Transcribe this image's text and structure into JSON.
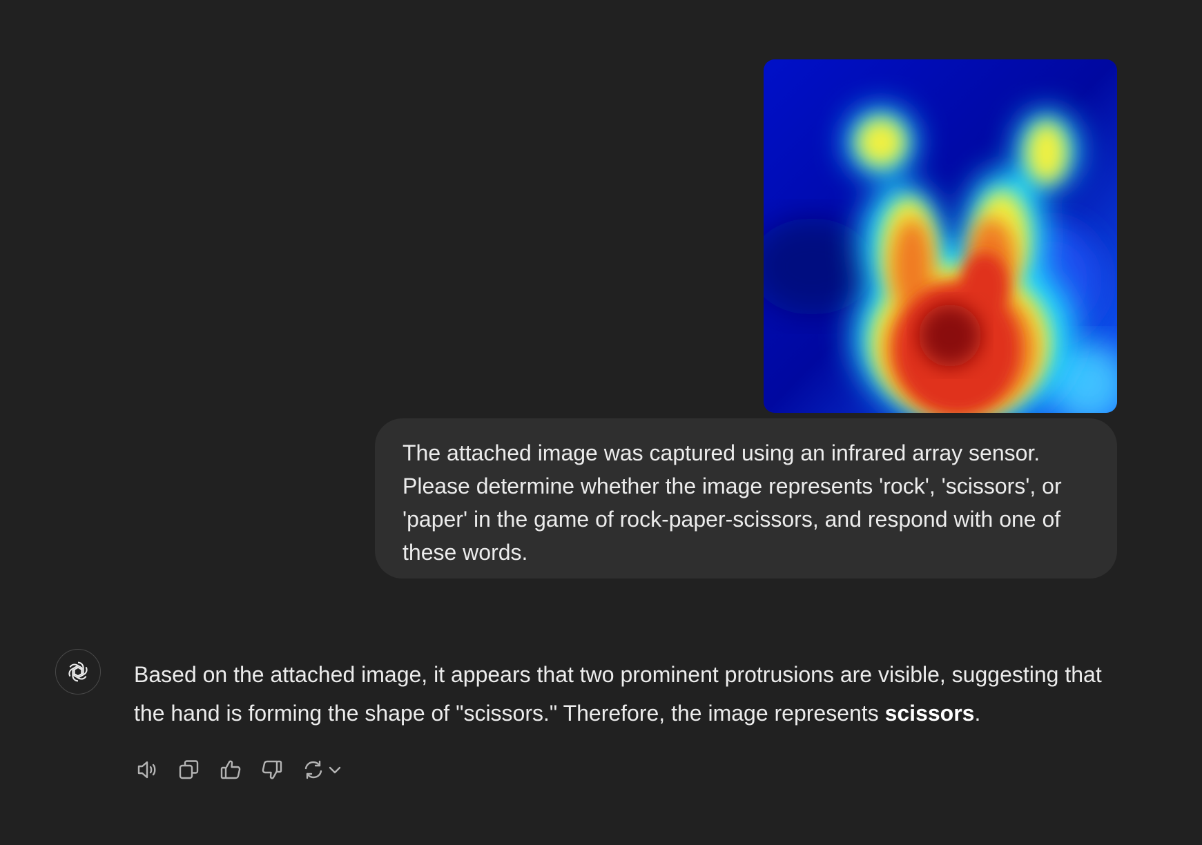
{
  "colors": {
    "background": "#212121",
    "user_bubble": "#2f2f2f",
    "text": "#ececec",
    "icon": "#b4b4b4"
  },
  "conversation": {
    "user_message": {
      "attachment_icon": "thermal-heatmap-image",
      "text": "The attached image was captured using an infrared array sensor. Please determine whether the image represents 'rock', 'scissors', or 'paper' in the game of rock-paper-scissors, and respond with one of these words."
    },
    "assistant_message": {
      "avatar_icon": "openai-logo-icon",
      "text_before_bold": "Based on the attached image, it appears that two prominent protrusions are visible, suggesting that the hand is forming the shape of \"scissors.\" Therefore, the image represents ",
      "bold_text": "scissors",
      "text_after_bold": "."
    },
    "actions": [
      {
        "name": "read-aloud",
        "icon": "speaker-icon"
      },
      {
        "name": "copy",
        "icon": "copy-icon"
      },
      {
        "name": "good-response",
        "icon": "thumbs-up-icon"
      },
      {
        "name": "bad-response",
        "icon": "thumbs-down-icon"
      },
      {
        "name": "regenerate",
        "icon": "refresh-icon"
      }
    ]
  }
}
